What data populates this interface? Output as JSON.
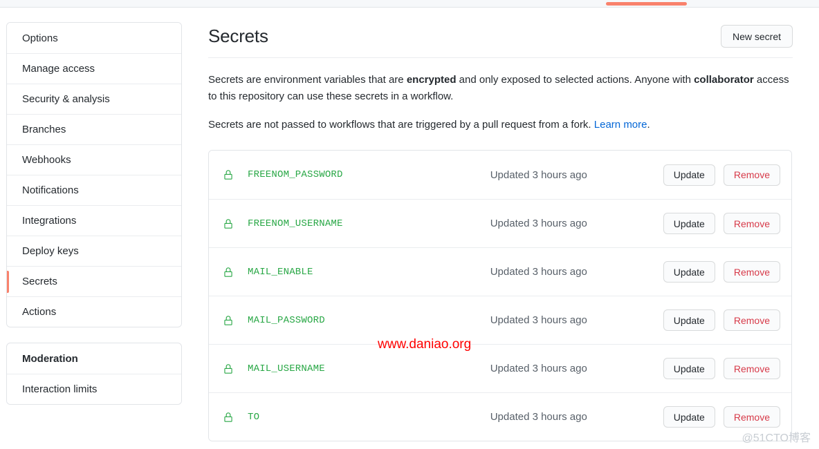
{
  "top_tab": {
    "indicator_color": "#f9826c"
  },
  "sidebar": {
    "groups": [
      {
        "items": [
          {
            "label": "Options",
            "selected": false
          },
          {
            "label": "Manage access",
            "selected": false
          },
          {
            "label": "Security & analysis",
            "selected": false
          },
          {
            "label": "Branches",
            "selected": false
          },
          {
            "label": "Webhooks",
            "selected": false
          },
          {
            "label": "Notifications",
            "selected": false
          },
          {
            "label": "Integrations",
            "selected": false
          },
          {
            "label": "Deploy keys",
            "selected": false
          },
          {
            "label": "Secrets",
            "selected": true
          },
          {
            "label": "Actions",
            "selected": false
          }
        ]
      },
      {
        "header": "Moderation",
        "items": [
          {
            "label": "Interaction limits",
            "selected": false
          }
        ]
      }
    ]
  },
  "main": {
    "title": "Secrets",
    "new_secret_label": "New secret",
    "description_1": {
      "part1": "Secrets are environment variables that are ",
      "bold1": "encrypted",
      "part2": " and only exposed to selected actions. Anyone with ",
      "bold2": "collaborator",
      "part3": " access to this repository can use these secrets in a workflow."
    },
    "description_2": {
      "part1": "Secrets are not passed to workflows that are triggered by a pull request from a fork. ",
      "link": "Learn more",
      "part2": "."
    },
    "row_actions": {
      "update_label": "Update",
      "remove_label": "Remove"
    },
    "secrets": [
      {
        "name": "FREENOM_PASSWORD",
        "updated": "Updated 3 hours ago"
      },
      {
        "name": "FREENOM_USERNAME",
        "updated": "Updated 3 hours ago"
      },
      {
        "name": "MAIL_ENABLE",
        "updated": "Updated 3 hours ago"
      },
      {
        "name": "MAIL_PASSWORD",
        "updated": "Updated 3 hours ago"
      },
      {
        "name": "MAIL_USERNAME",
        "updated": "Updated 3 hours ago"
      },
      {
        "name": "TO",
        "updated": "Updated 3 hours ago"
      }
    ]
  },
  "watermarks": {
    "center": "www.daniao.org",
    "corner": "@51CTO博客"
  },
  "colors": {
    "secret_green": "#28a745",
    "remove_red": "#d73a49",
    "link_blue": "#0366d6",
    "selected_accent": "#f9826c",
    "watermark_red": "#ff0000"
  }
}
